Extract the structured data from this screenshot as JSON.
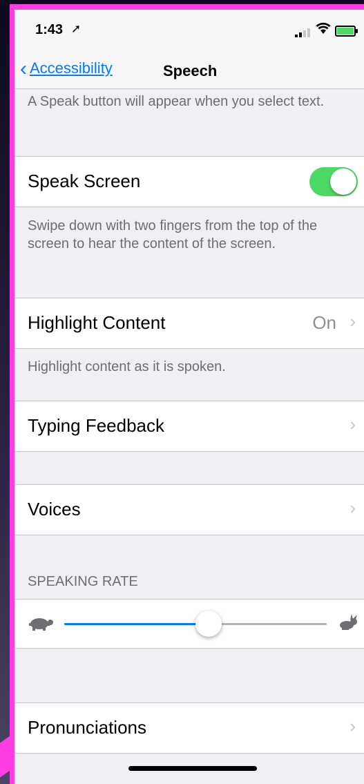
{
  "status": {
    "time": "1:43",
    "location_icon": "location-arrow-icon"
  },
  "nav": {
    "back_label": "Accessibility",
    "title": "Speech"
  },
  "speak_selection_footer": "A Speak button will appear when you select text.",
  "speak_screen": {
    "label": "Speak Screen",
    "enabled": true,
    "footer": "Swipe down with two fingers from the top of the screen to hear the content of the screen."
  },
  "highlight_content": {
    "label": "Highlight Content",
    "value": "On",
    "footer": "Highlight content as it is spoken."
  },
  "typing_feedback": {
    "label": "Typing Feedback"
  },
  "voices": {
    "label": "Voices"
  },
  "speaking_rate": {
    "header": "SPEAKING RATE",
    "value": 0.55
  },
  "pronunciations": {
    "label": "Pronunciations"
  },
  "colors": {
    "accent": "#007aff",
    "toggle_on": "#4cd964",
    "frame": "#ff3de0"
  }
}
